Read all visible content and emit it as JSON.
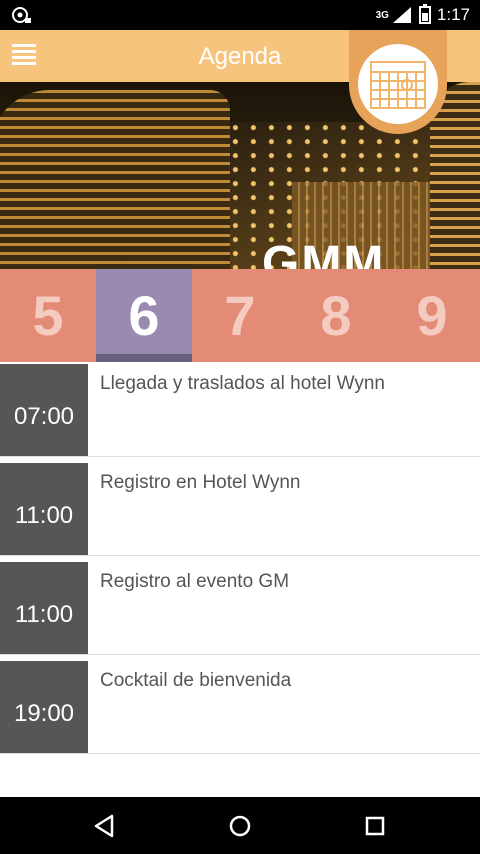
{
  "status_bar": {
    "network": "3G",
    "time": "1:17",
    "icons": [
      "notification-icon",
      "signal-icon",
      "battery-icon"
    ]
  },
  "app_bar": {
    "title": "Agenda",
    "menu_icon": "hamburger-menu-icon",
    "badge_icon": "calendar-icon"
  },
  "hero": {
    "sign_text": "GMM"
  },
  "days": {
    "items": [
      "5",
      "6",
      "7",
      "8",
      "9"
    ],
    "selected": "6"
  },
  "events": [
    {
      "time": "07:00",
      "title": "Llegada y traslados al hotel Wynn"
    },
    {
      "time": "11:00",
      "title": "Registro en Hotel Wynn"
    },
    {
      "time": "11:00",
      "title": "Registro al evento GM"
    },
    {
      "time": "19:00",
      "title": "Cocktail de bienvenida"
    }
  ],
  "nav_bar": {
    "buttons": [
      "back-icon",
      "home-icon",
      "recents-icon"
    ]
  },
  "colors": {
    "app_bar": "#f7c47e",
    "badge": "#e8a35a",
    "days_bg": "#e38b76",
    "day_selected": "#9a8ab0",
    "time_block": "#565656"
  }
}
